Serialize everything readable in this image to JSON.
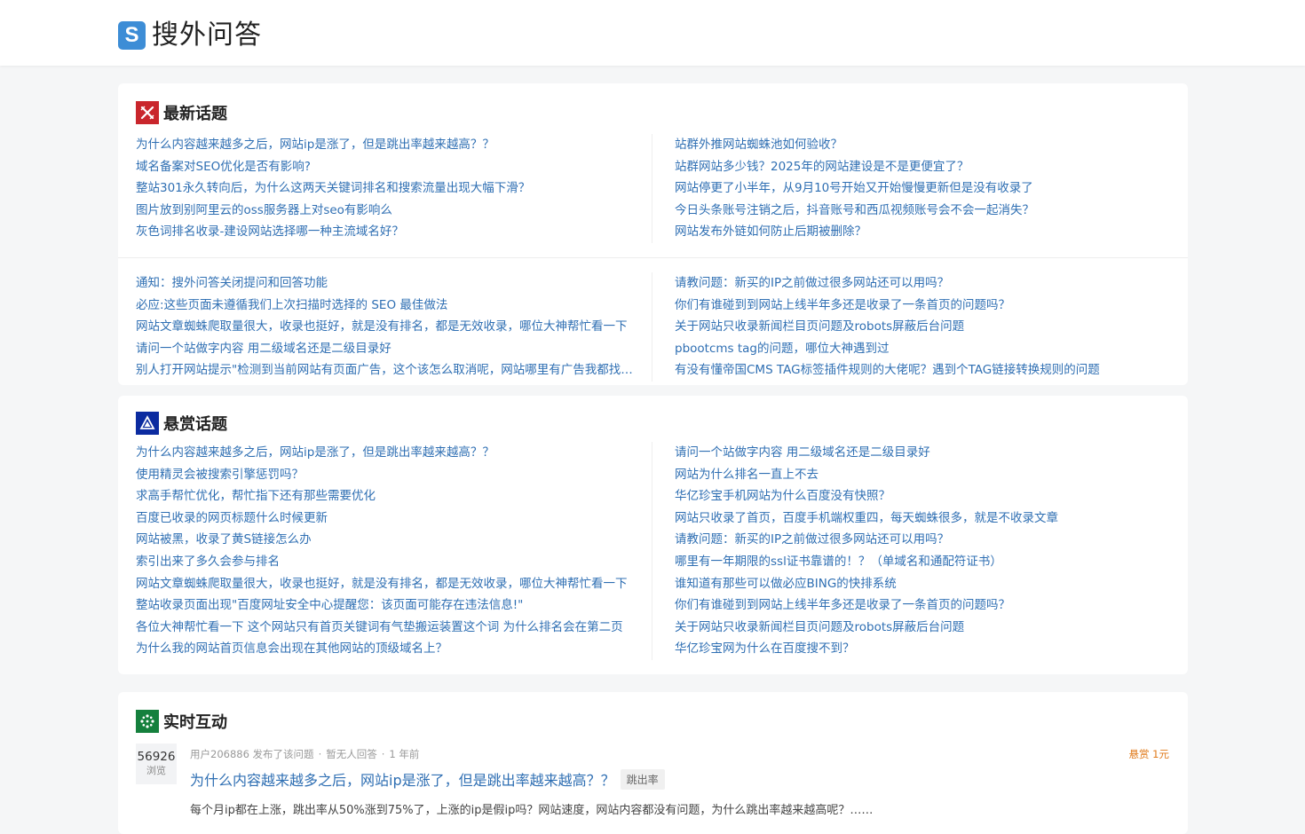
{
  "site": {
    "logo_letter": "S",
    "logo_text": "搜外问答"
  },
  "latest": {
    "title": "最新话题",
    "icon": "crossed-swords-icon",
    "group1_left": [
      "为什么内容越来越多之后，网站ip是涨了，但是跳出率越来越高？？",
      "域名备案对SEO优化是否有影响?",
      "整站301永久转向后，为什么这两天关键词排名和搜索流量出现大幅下滑？",
      "图片放到别阿里云的oss服务器上对seo有影响么",
      "灰色词排名收录-建设网站选择哪一种主流域名好？"
    ],
    "group1_right": [
      "站群外推网站蜘蛛池如何验收？",
      "站群网站多少钱？2025年的网站建设是不是更便宜了？",
      "网站停更了小半年，从9月10号开始又开始慢慢更新但是没有收录了",
      "今日头条账号注销之后，抖音账号和西瓜视频账号会不会一起消失？",
      "网站发布外链如何防止后期被删除？"
    ],
    "group2_left": [
      "通知：搜外问答关闭提问和回答功能",
      "必应:这些页面未遵循我们上次扫描时选择的 SEO 最佳做法",
      "网站文章蜘蛛爬取量很大，收录也挺好，就是没有排名，都是无效收录，哪位大神帮忙看一下",
      "请问一个站做字内容 用二级域名还是二级目录好",
      "别人打开网站提示\"检测到当前网站有页面广告，这个该怎么取消呢，网站哪里有广告我都找不到"
    ],
    "group2_right": [
      "请教问题：新买的IP之前做过很多网站还可以用吗？",
      "你们有谁碰到到网站上线半年多还是收录了一条首页的问题吗？",
      "关于网站只收录新闻栏目页问题及robots屏蔽后台问题",
      "pbootcms tag的问题，哪位大神遇到过",
      "有没有懂帝国CMS TAG标签插件规则的大佬呢？遇到个TAG链接转换规则的问题"
    ]
  },
  "bounty": {
    "title": "悬赏话题",
    "icon": "triangle-badge-icon",
    "left": [
      "为什么内容越来越多之后，网站ip是涨了，但是跳出率越来越高？？",
      "使用精灵会被搜索引擎惩罚吗？",
      "求高手帮忙优化，帮忙指下还有那些需要优化",
      "百度已收录的网页标题什么时候更新",
      "网站被黑，收录了黄S链接怎么办",
      "索引出来了多久会参与排名",
      "网站文章蜘蛛爬取量很大，收录也挺好，就是没有排名，都是无效收录，哪位大神帮忙看一下",
      "整站收录页面出现\"百度网址安全中心提醒您：该页面可能存在违法信息!\"",
      "各位大神帮忙看一下 这个网站只有首页关键词有气垫搬运装置这个词 为什么排名会在第二页",
      "为什么我的网站首页信息会出现在其他网站的顶级域名上？"
    ],
    "right": [
      "请问一个站做字内容 用二级域名还是二级目录好",
      "网站为什么排名一直上不去",
      "华亿珍宝手机网站为什么百度没有快照？",
      "网站只收录了首页，百度手机端权重四，每天蜘蛛很多，就是不收录文章",
      "请教问题：新买的IP之前做过很多网站还可以用吗？",
      "哪里有一年期限的ssl证书靠谱的！？（单域名和通配符证书）",
      "谁知道有那些可以做必应BING的快排系统",
      "你们有谁碰到到网站上线半年多还是收录了一条首页的问题吗？",
      "关于网站只收录新闻栏目页问题及robots屏蔽后台问题",
      "华亿珍宝网为什么在百度搜不到？"
    ]
  },
  "live": {
    "title": "实时互动",
    "icon": "dots-ring-icon",
    "question": {
      "views": "56926",
      "views_label": "浏览",
      "user": "用户206886 发布了该问题",
      "answers": "暂无人回答",
      "time": "1 年前",
      "bounty": "悬赏 1元",
      "title": "为什么内容越来越多之后，网站ip是涨了，但是跳出率越来越高？？",
      "tag": "跳出率",
      "excerpt": "每个月ip都在上涨，跳出率从50%涨到75%了，上涨的ip是假ip吗？网站速度，网站内容都没有问题，为什么跳出率越来越高呢？……"
    }
  },
  "colors": {
    "link": "#2f6fb3",
    "latest_icon_bg": "#c9262c",
    "bounty_icon_bg": "#0b2ba0",
    "live_icon_bg": "#15803d",
    "bounty_text": "#e07a1a"
  }
}
